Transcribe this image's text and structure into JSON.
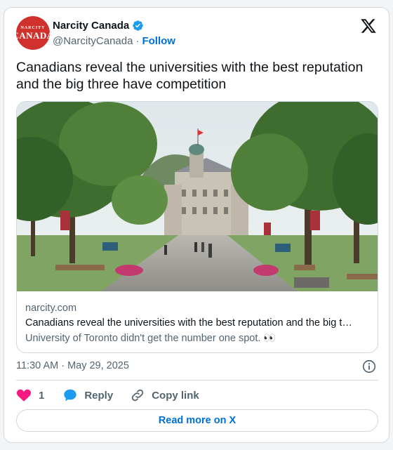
{
  "author": {
    "avatar_line1": "NARCITY",
    "avatar_line2": "CANADA",
    "name": "Narcity Canada",
    "handle": "@NarcityCanada",
    "separator": "·",
    "follow_label": "Follow",
    "verified_icon": "verified-badge-icon"
  },
  "post": {
    "text": "Canadians reveal the universities with the best reputation and the big three have competition",
    "timestamp": "11:30 AM · May 29, 2025"
  },
  "link_card": {
    "domain": "narcity.com",
    "title": "Canadians reveal the universities with the best reputation and the big t…",
    "description": "University of Toronto didn't get the number one spot. 👀"
  },
  "actions": {
    "like_count": "1",
    "reply_label": "Reply",
    "copy_link_label": "Copy link"
  },
  "read_more_label": "Read more on X",
  "colors": {
    "accent": "#006fd6",
    "like": "#f91880",
    "reply": "#1d9bf0",
    "avatar_bg": "#d0312d"
  }
}
